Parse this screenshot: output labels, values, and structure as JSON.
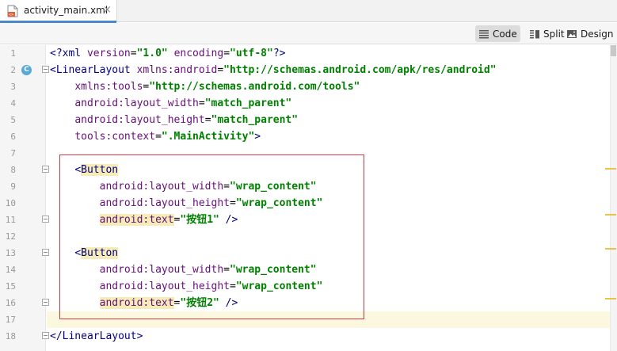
{
  "tab": {
    "filename": "activity_main.xml",
    "file_icon": "xml-file-icon",
    "close_glyph": "×"
  },
  "toolbar": {
    "modes": [
      {
        "label": "Code",
        "icon": "code-lines-icon",
        "selected": true
      },
      {
        "label": "Split",
        "icon": "split-view-icon",
        "selected": false
      },
      {
        "label": "Design",
        "icon": "image-icon",
        "selected": false
      }
    ]
  },
  "editor": {
    "gutter_badge": "C",
    "current_line": 17,
    "line_numbers": [
      "1",
      "2",
      "3",
      "4",
      "5",
      "6",
      "7",
      "8",
      "9",
      "10",
      "11",
      "12",
      "13",
      "14",
      "15",
      "16",
      "17",
      "18"
    ],
    "lines": {
      "l1": {
        "tag": "<?xml ",
        "attr1": "version",
        "eq1": "=",
        "val1": "\"1.0\"",
        "sp": " ",
        "attr2": "encoding",
        "eq2": "=",
        "val2": "\"utf-8\"",
        "end": "?>"
      },
      "l2": {
        "tag": "<LinearLayout ",
        "attr": "xmlns:android",
        "eq": "=",
        "val": "\"http://schemas.android.com/apk/res/android\""
      },
      "l3": {
        "indent": "    ",
        "attr": "xmlns:tools",
        "eq": "=",
        "val": "\"http://schemas.android.com/tools\""
      },
      "l4": {
        "indent": "    ",
        "attr": "android:layout_width",
        "eq": "=",
        "val": "\"match_parent\""
      },
      "l5": {
        "indent": "    ",
        "attr": "android:layout_height",
        "eq": "=",
        "val": "\"match_parent\""
      },
      "l6": {
        "indent": "    ",
        "attr": "tools:context",
        "eq": "=",
        "val": "\".MainActivity\"",
        "end": ">"
      },
      "l8": {
        "indent": "    ",
        "lt": "<",
        "tag": "Button"
      },
      "l9": {
        "indent": "        ",
        "attr": "android:layout_width",
        "eq": "=",
        "val": "\"wrap_content\""
      },
      "l10": {
        "indent": "        ",
        "attr": "android:layout_height",
        "eq": "=",
        "val": "\"wrap_content\""
      },
      "l11": {
        "indent": "        ",
        "attr": "android:text",
        "eq": "=",
        "val": "\"按钮1\"",
        "end": " />"
      },
      "l13": {
        "indent": "    ",
        "lt": "<",
        "tag": "Button"
      },
      "l14": {
        "indent": "        ",
        "attr": "android:layout_width",
        "eq": "=",
        "val": "\"wrap_content\""
      },
      "l15": {
        "indent": "        ",
        "attr": "android:layout_height",
        "eq": "=",
        "val": "\"wrap_content\""
      },
      "l16": {
        "indent": "        ",
        "attr": "android:text",
        "eq": "=",
        "val": "\"按钮2\"",
        "end": " />"
      },
      "l18": {
        "tag": "</LinearLayout>"
      }
    }
  },
  "colors": {
    "tag": "#000080",
    "attribute": "#660e7a",
    "string_value": "#008000",
    "highlight_box": "#d9363e",
    "current_line_bg": "#fcf8e0",
    "tab_accent": "#4a88c7"
  }
}
